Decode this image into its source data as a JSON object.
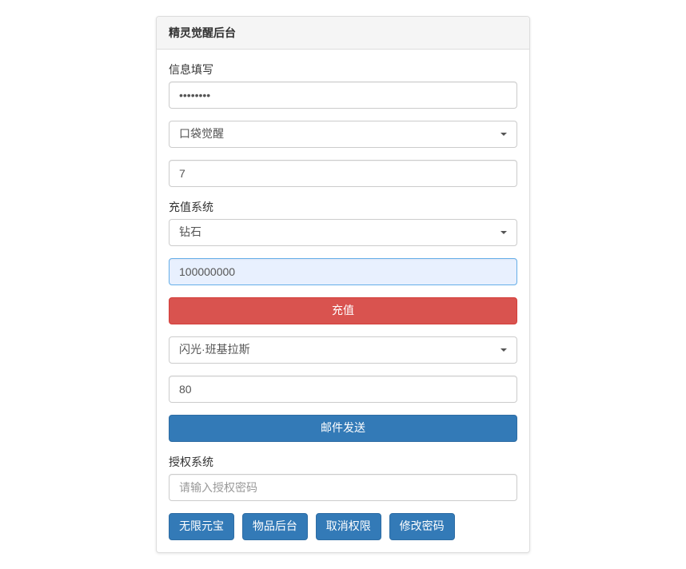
{
  "panel": {
    "title": "精灵觉醒后台"
  },
  "info": {
    "label": "信息填写",
    "password_value": "••••••••",
    "gate_selected": "口袋觉醒",
    "region_value": "7"
  },
  "recharge": {
    "label": "充值系统",
    "currency_selected": "钻石",
    "amount_value": "100000000",
    "button_label": "充值"
  },
  "mail": {
    "item_selected": "闪光·班基拉斯",
    "quantity_value": "80",
    "button_label": "邮件发送"
  },
  "auth": {
    "label": "授权系统",
    "placeholder": "请输入授权密码"
  },
  "buttons": {
    "unlimited": "无限元宝",
    "item_back": "物品后台",
    "revoke": "取消权限",
    "change_pw": "修改密码"
  }
}
